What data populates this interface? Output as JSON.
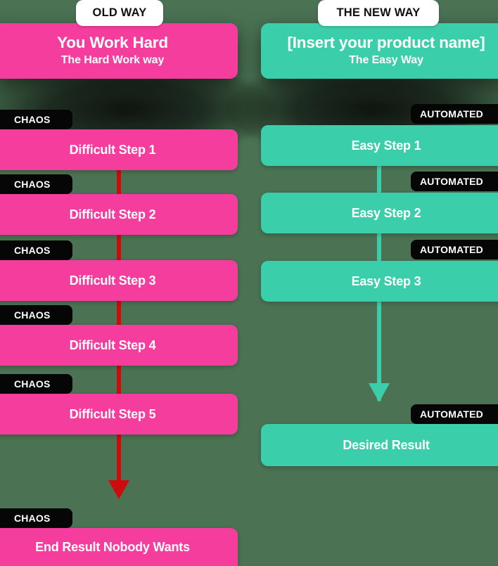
{
  "colors": {
    "background": "#4a7253",
    "old_way_accent": "#f53d9e",
    "new_way_accent": "#3bceaa",
    "old_way_line": "#cc0b0b",
    "badge_background": "#060606",
    "tab_background": "#ffffff",
    "text_on_accent": "#ffffff"
  },
  "columns": {
    "old": {
      "tab_label": "OLD WAY",
      "header": {
        "title": "You Work Hard",
        "subtitle": "The Hard Work way"
      },
      "badge_label": "CHAOS",
      "steps": [
        {
          "label": "Difficult Step 1",
          "badge": "CHAOS"
        },
        {
          "label": "Difficult Step 2",
          "badge": "CHAOS"
        },
        {
          "label": "Difficult Step 3",
          "badge": "CHAOS"
        },
        {
          "label": "Difficult Step 4",
          "badge": "CHAOS"
        },
        {
          "label": "Difficult Step 5",
          "badge": "CHAOS"
        }
      ],
      "result": {
        "label": "End Result Nobody Wants",
        "badge": "CHAOS"
      }
    },
    "new": {
      "tab_label": "THE NEW WAY",
      "header": {
        "title": "[Insert your product name]",
        "subtitle": "The Easy Way"
      },
      "badge_label": "AUTOMATED",
      "steps": [
        {
          "label": "Easy Step 1",
          "badge": "AUTOMATED"
        },
        {
          "label": "Easy Step 2",
          "badge": "AUTOMATED"
        },
        {
          "label": "Easy Step 3",
          "badge": "AUTOMATED"
        }
      ],
      "result": {
        "label": "Desired Result",
        "badge": "AUTOMATED"
      }
    }
  }
}
